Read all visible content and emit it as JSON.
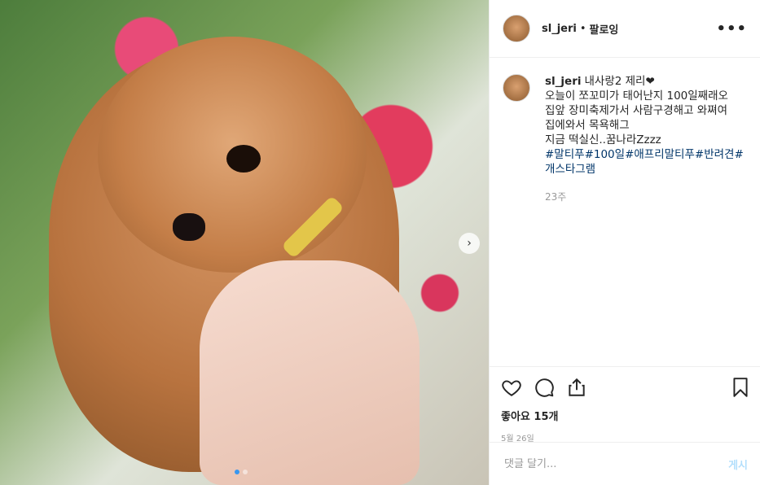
{
  "post": {
    "username": "sl_jeri",
    "separator": "•",
    "follow_label": "팔로잉",
    "more_label": "•••",
    "caption_lines": [
      "내사랑2 제리❤",
      "오늘이 쪼꼬미가 태어난지 100일째래오",
      "집앞 장미축제가서 사람구경해고 와쪄여",
      "집에와서 목욕해그",
      "지금 떡실신..꿈나라Zzzz"
    ],
    "hashtags": "#말티푸#100일#애프리말티푸#반려견#개스타그램",
    "comment_time": "23주",
    "likes": "좋아요 15개",
    "date": "5월 26일",
    "comment_placeholder": "댓글 달기...",
    "post_button": "게시",
    "next_arrow": "›"
  },
  "icons": [
    "heart-icon",
    "comment-icon",
    "share-icon",
    "bookmark-icon"
  ],
  "colors": {
    "link": "#003569",
    "active_dot": "#3897f0",
    "post_button": "#b2dffc"
  }
}
